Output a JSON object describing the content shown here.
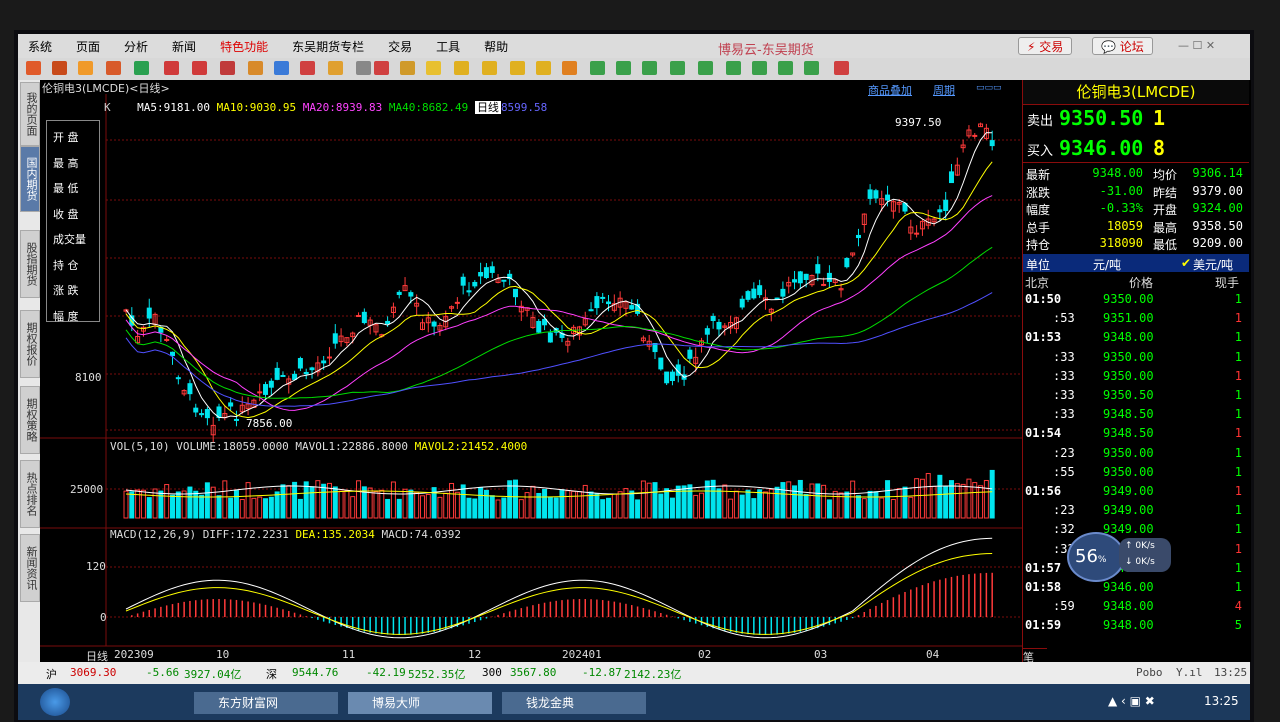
{
  "menu": [
    "系统",
    "页面",
    "分析",
    "新闻",
    "特色功能",
    "东吴期货专栏",
    "交易",
    "工具",
    "帮助"
  ],
  "app_title": "博易云-东吴期货",
  "trade_btn": "交易",
  "forum_btn": "论坛",
  "left_tabs": [
    "我的页面",
    "国内期货",
    "股指期货",
    "期权报价",
    "期权策略",
    "热点排名",
    "新闻资讯"
  ],
  "chart": {
    "instrument_label": "伦铜电3(LMCDE)<日线>",
    "k_label": "K",
    "ma5": "MA5:9181.00",
    "ma10": "MA10:9030.95",
    "ma20": "MA20:8939.83",
    "ma40": "MA40:8682.49",
    "ma_extra": "8599.58",
    "period_tag": "日线",
    "overlay_link": "商品叠加",
    "period_link": "周期",
    "high_label": "9397.50",
    "low_label": "7856.00",
    "ytick": "8100",
    "vol_title": "VOL(5,10) VOLUME:18059.0000 MAVOL1:22886.8000",
    "vol_mavol2": "MAVOL2:21452.4000",
    "vol_tick": "25000",
    "macd_title": "MACD(12,26,9)",
    "macd_diff": "DIFF:172.2231",
    "macd_dea": "DEA:135.2034",
    "macd_val": "MACD:74.0392",
    "macd_tick1": "120",
    "macd_tick2": "0",
    "xaxis": [
      "日线",
      "202309",
      "10",
      "11",
      "12",
      "202401",
      "02",
      "03",
      "04"
    ],
    "legend_items": [
      "开 盘",
      "最 高",
      "最 低",
      "收 盘",
      "成交量",
      "持 仓",
      "涨 跌",
      "幅 度"
    ]
  },
  "quote": {
    "title": "伦铜电3(LMCDE)",
    "sell_label": "卖出",
    "sell_price": "9350.50",
    "sell_qty": "1",
    "buy_label": "买入",
    "buy_price": "9346.00",
    "buy_qty": "8",
    "rows": [
      {
        "l1": "最新",
        "v1": "9348.00",
        "l2": "均价",
        "v2": "9306.14"
      },
      {
        "l1": "涨跌",
        "v1": "-31.00",
        "l2": "昨结",
        "v2": "9379.00"
      },
      {
        "l1": "幅度",
        "v1": "-0.33%",
        "l2": "开盘",
        "v2": "9324.00"
      },
      {
        "l1": "总手",
        "v1": "18059",
        "l2": "最高",
        "v2": "9358.50"
      },
      {
        "l1": "持仓",
        "v1": "318090",
        "l2": "最低",
        "v2": "9209.00"
      }
    ],
    "unit_label": "单位",
    "unit_value": "元/吨",
    "unit_alt": "美元/吨",
    "tick_headers": [
      "北京",
      "价格",
      "现手"
    ],
    "ticks": [
      {
        "t": "01:50",
        "p": "9350.00",
        "q": "1"
      },
      {
        "t": ":53",
        "p": "9351.00",
        "q": "1"
      },
      {
        "t": "01:53",
        "p": "9348.00",
        "q": "1"
      },
      {
        "t": ":33",
        "p": "9350.00",
        "q": "1"
      },
      {
        "t": ":33",
        "p": "9350.00",
        "q": "1"
      },
      {
        "t": ":33",
        "p": "9350.50",
        "q": "1"
      },
      {
        "t": ":33",
        "p": "9348.50",
        "q": "1"
      },
      {
        "t": "01:54",
        "p": "9348.50",
        "q": "1"
      },
      {
        "t": ":23",
        "p": "9350.00",
        "q": "1"
      },
      {
        "t": ":55",
        "p": "9350.00",
        "q": "1"
      },
      {
        "t": "01:56",
        "p": "9349.00",
        "q": "1"
      },
      {
        "t": ":23",
        "p": "9349.00",
        "q": "1"
      },
      {
        "t": ":32",
        "p": "9349.00",
        "q": "1"
      },
      {
        "t": ":32",
        "p": "9348.00",
        "q": "1"
      },
      {
        "t": "01:57",
        "p": "9348.00",
        "q": "1"
      },
      {
        "t": "01:58",
        "p": "9346.00",
        "q": "1"
      },
      {
        "t": ":59",
        "p": "9348.00",
        "q": "4"
      },
      {
        "t": "01:59",
        "p": "9348.00",
        "q": "5"
      }
    ],
    "net_percent": "56",
    "net_up": "0K/s",
    "net_down": "0K/s",
    "bottom_tab": "笔"
  },
  "status": {
    "sh_label": "沪",
    "sh_val": "3069.30",
    "sh_chg": "-5.66",
    "sh_amt": "3927.04亿",
    "sz_label": "深",
    "sz_val": "9544.76",
    "sz_chg": "-42.19",
    "sz_amt": "5252.35亿",
    "c300_label": "300",
    "c300_val": "3567.80",
    "c300_chg": "-12.87",
    "c300_amt": "2142.23亿",
    "pobo": "Pobo",
    "time": "13:25"
  },
  "taskbar": {
    "items": [
      "东方财富网",
      "博易大师",
      "钱龙金典"
    ],
    "clock": "13:25"
  },
  "colors": {
    "up": "#ff3a3a",
    "down": "#00e5ee",
    "ma5": "#ffffff",
    "ma10": "#ffff00",
    "ma20": "#ff40ff",
    "ma40": "#00dd00",
    "ma60": "#5050ff",
    "grid": "#7a0c0c"
  }
}
